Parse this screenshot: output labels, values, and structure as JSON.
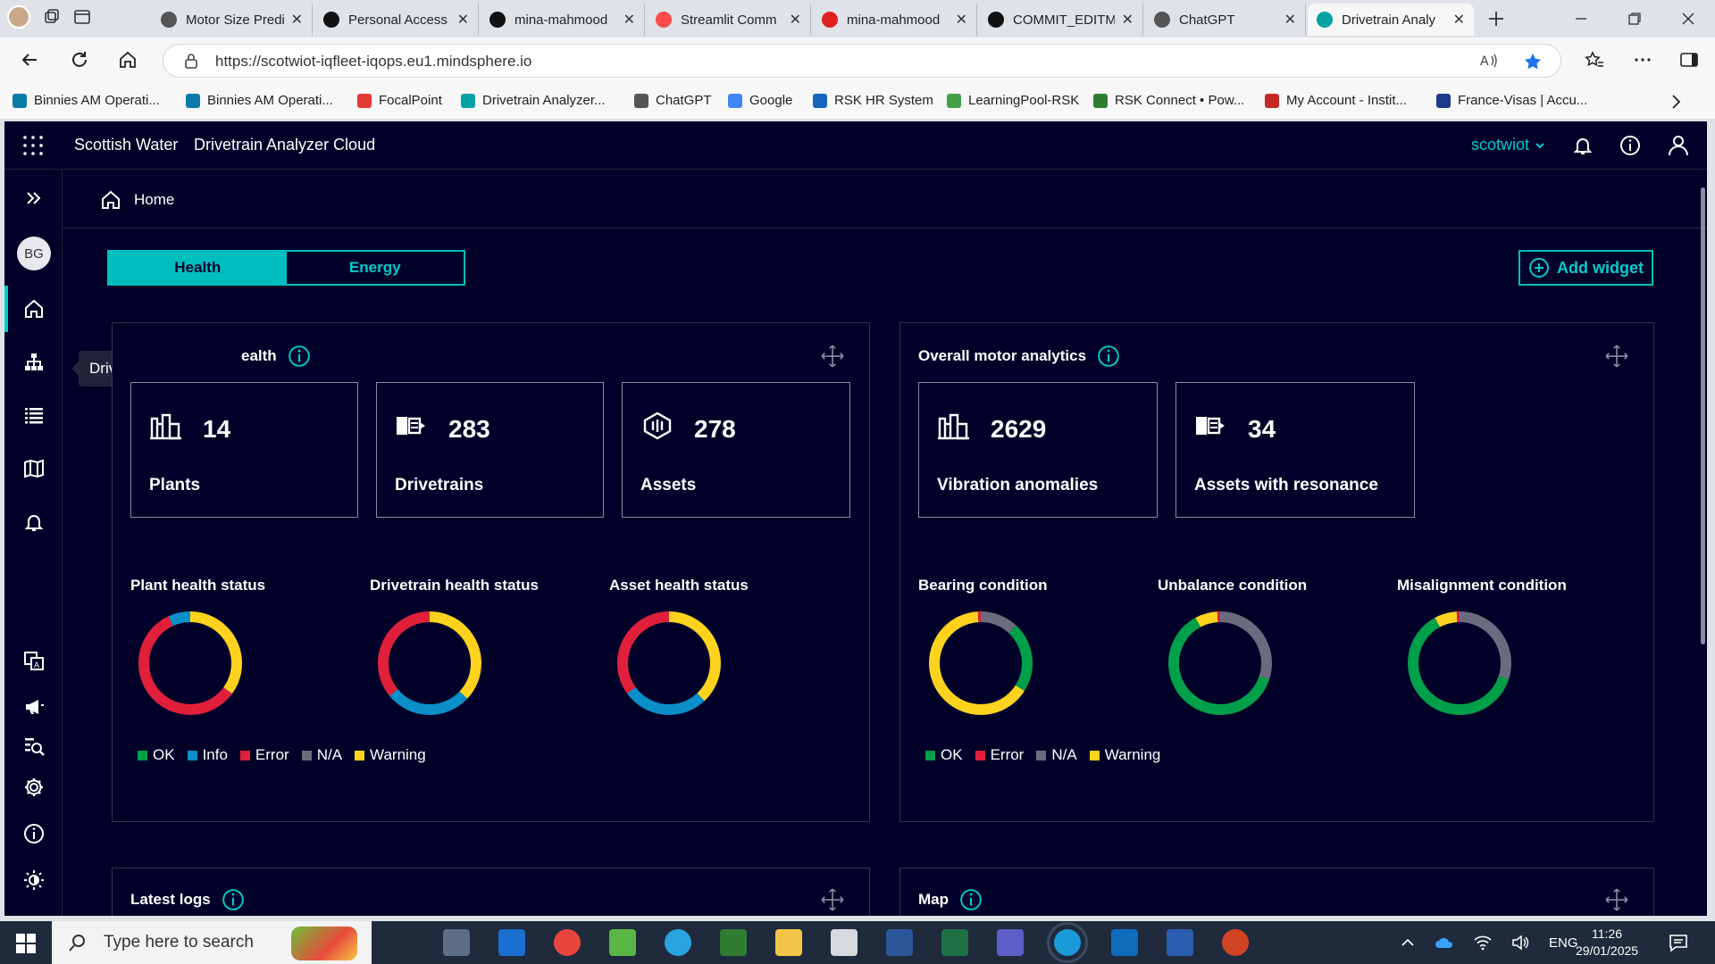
{
  "browser": {
    "tabs": [
      {
        "title": "Motor Size Predi",
        "icon": "chatgpt-icon",
        "color": "#555555"
      },
      {
        "title": "Personal Access",
        "icon": "github-icon",
        "color": "#111111"
      },
      {
        "title": "mina-mahmood",
        "icon": "github-icon",
        "color": "#111111"
      },
      {
        "title": "Streamlit Comm",
        "icon": "streamlit-icon",
        "color": "#ff4b4b"
      },
      {
        "title": "mina-mahmood",
        "icon": "streamlit-icon",
        "color": "#e02020"
      },
      {
        "title": "COMMIT_EDITM",
        "icon": "github-icon",
        "color": "#111111"
      },
      {
        "title": "ChatGPT",
        "icon": "chatgpt-icon",
        "color": "#555555"
      },
      {
        "title": "Drivetrain Analy",
        "icon": "drivetrain-icon",
        "color": "#00a3a3"
      }
    ],
    "url": "https://scotwiot-iqfleet-iqops.eu1.mindsphere.io",
    "bookmarks": [
      {
        "label": "Binnies AM Operati...",
        "color": "#0a7ba8"
      },
      {
        "label": "Binnies AM Operati...",
        "color": "#0a7ba8"
      },
      {
        "label": "FocalPoint",
        "color": "#e53935"
      },
      {
        "label": "Drivetrain Analyzer...",
        "color": "#00a3a3"
      },
      {
        "label": "ChatGPT",
        "color": "#555555"
      },
      {
        "label": "Google",
        "color": "#4285f4"
      },
      {
        "label": "RSK HR System",
        "color": "#1565c0"
      },
      {
        "label": "LearningPool-RSK",
        "color": "#43a047"
      },
      {
        "label": "RSK Connect • Pow...",
        "color": "#2e7d32"
      },
      {
        "label": "My Account - Instit...",
        "color": "#c62828"
      },
      {
        "label": "France-Visas | Accu...",
        "color": "#1e3a8a"
      }
    ]
  },
  "app": {
    "org": "Scottish Water",
    "product": "Drivetrain Analyzer Cloud",
    "tenant": "scotwiot",
    "avatar_initials": "BG",
    "tooltip": "Drivetrain hierarchy",
    "breadcrumb": "Home",
    "toggle": {
      "health": "Health",
      "energy": "Energy"
    },
    "add_widget": "Add widget",
    "accent": "#00cccc"
  },
  "fleet_panel": {
    "title": "ealth",
    "kpis": [
      {
        "value": "14",
        "label": "Plants",
        "icon": "factory-icon"
      },
      {
        "value": "283",
        "label": "Drivetrains",
        "icon": "drivetrain-icon"
      },
      {
        "value": "278",
        "label": "Assets",
        "icon": "asset-icon"
      }
    ],
    "charts": [
      "Plant health status",
      "Drivetrain health status",
      "Asset health status"
    ],
    "legend": [
      {
        "label": "OK",
        "color": "#00a04a"
      },
      {
        "label": "Info",
        "color": "#0a8fc8"
      },
      {
        "label": "Error",
        "color": "#e0203a"
      },
      {
        "label": "N/A",
        "color": "#6b6b80"
      },
      {
        "label": "Warning",
        "color": "#ffd21e"
      }
    ]
  },
  "motor_panel": {
    "title": "Overall motor analytics",
    "kpis": [
      {
        "value": "2629",
        "label": "Vibration anomalies",
        "icon": "factory-icon"
      },
      {
        "value": "34",
        "label": "Assets with resonance",
        "icon": "drivetrain-icon"
      }
    ],
    "charts": [
      "Bearing condition",
      "Unbalance condition",
      "Misalignment condition"
    ],
    "legend": [
      {
        "label": "OK",
        "color": "#00a04a"
      },
      {
        "label": "Error",
        "color": "#e0203a"
      },
      {
        "label": "N/A",
        "color": "#6b6b80"
      },
      {
        "label": "Warning",
        "color": "#ffd21e"
      }
    ]
  },
  "bottom_panels": {
    "logs": "Latest logs",
    "map": "Map"
  },
  "chart_data": [
    {
      "type": "pie",
      "title": "Plant health status",
      "categories": [
        "Warning",
        "Error",
        "Info"
      ],
      "values": [
        35,
        58,
        7
      ]
    },
    {
      "type": "pie",
      "title": "Drivetrain health status",
      "categories": [
        "Warning",
        "Info",
        "Error"
      ],
      "values": [
        37,
        27,
        36
      ]
    },
    {
      "type": "pie",
      "title": "Asset health status",
      "categories": [
        "Warning",
        "Info",
        "Error"
      ],
      "values": [
        38,
        27,
        35
      ]
    },
    {
      "type": "pie",
      "title": "Bearing condition",
      "categories": [
        "N/A",
        "OK",
        "Warning",
        "Error"
      ],
      "values": [
        12,
        22,
        65,
        1
      ]
    },
    {
      "type": "pie",
      "title": "Unbalance condition",
      "categories": [
        "N/A",
        "OK",
        "Warning",
        "Error"
      ],
      "values": [
        30,
        62,
        7,
        1
      ]
    },
    {
      "type": "pie",
      "title": "Misalignment condition",
      "categories": [
        "N/A",
        "OK",
        "Warning",
        "Error"
      ],
      "values": [
        30,
        62,
        7,
        1
      ]
    }
  ],
  "taskbar": {
    "search_placeholder": "Type here to search",
    "language": "ENG",
    "time": "11:26",
    "date": "29/01/2025"
  }
}
